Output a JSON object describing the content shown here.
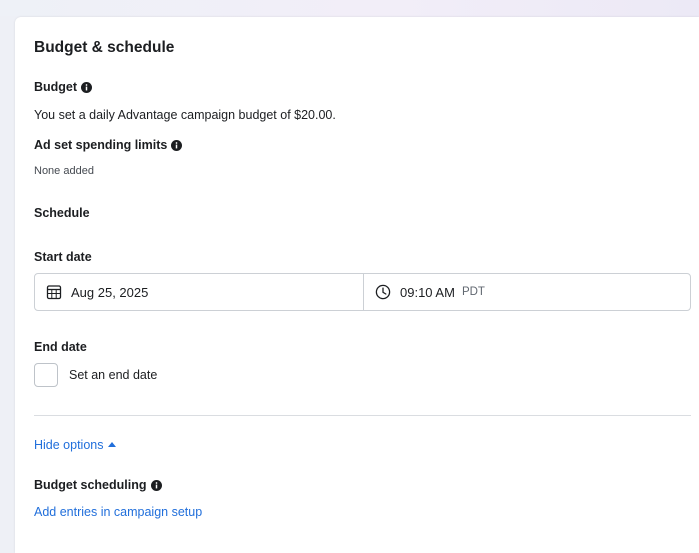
{
  "section": {
    "title": "Budget & schedule"
  },
  "budget": {
    "label": "Budget",
    "description": "You set a daily Advantage campaign budget of $20.00."
  },
  "spending_limits": {
    "label": "Ad set spending limits",
    "value": "None added"
  },
  "schedule": {
    "label": "Schedule",
    "start_date": {
      "label": "Start date",
      "date": "Aug 25, 2025",
      "time": "09:10 AM",
      "timezone": "PDT"
    },
    "end_date": {
      "label": "End date",
      "checkbox_label": "Set an end date",
      "checked": false
    }
  },
  "options": {
    "toggle_label": "Hide options"
  },
  "budget_scheduling": {
    "label": "Budget scheduling",
    "link": "Add entries in campaign setup"
  },
  "colors": {
    "link": "#216fdb",
    "text": "#1c1e21",
    "border": "#ccd0d5"
  },
  "icons": {
    "info": "info-icon",
    "calendar": "calendar-icon",
    "clock": "clock-icon",
    "caret": "caret-up-icon"
  }
}
